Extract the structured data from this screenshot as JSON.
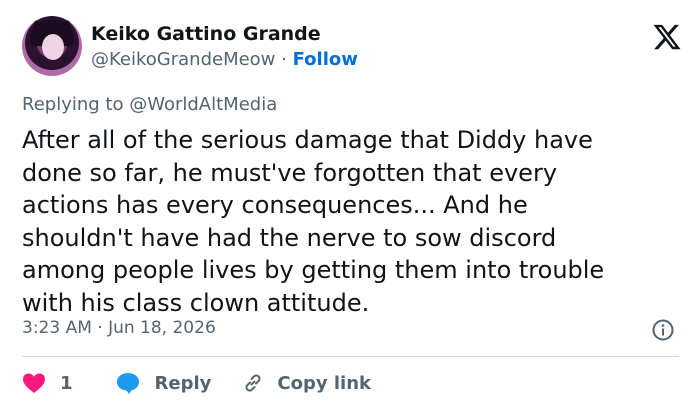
{
  "author": {
    "name": "Keiko Gattino Grande",
    "handle": "@KeikoGrandeMeow",
    "separator": "·",
    "follow_label": "Follow"
  },
  "reply_context": {
    "prefix": "Replying to",
    "mention": "@WorldAltMedia"
  },
  "tweet": {
    "text": "After all of the serious damage that Diddy have\ndone so far, he must've forgotten that every\nactions has every consequences... And he\nshouldn't have had the nerve to sow discord\namong people lives by getting them into trouble\nwith his class clown attitude."
  },
  "meta": {
    "timestamp": "3:23 AM · Jun 18, 2026"
  },
  "actions": {
    "like_count": "1",
    "reply_label": "Reply",
    "copy_link_label": "Copy link"
  },
  "icons": {
    "brand": "x-logo-icon",
    "info": "info-icon",
    "like": "heart-icon",
    "reply": "reply-bubble-icon",
    "copy": "link-icon"
  },
  "colors": {
    "text": "#0f1419",
    "secondary": "#536471",
    "follow": "#006fd6",
    "like": "#f91880",
    "reply": "#1d9bf0",
    "divider": "#cfd9de"
  }
}
